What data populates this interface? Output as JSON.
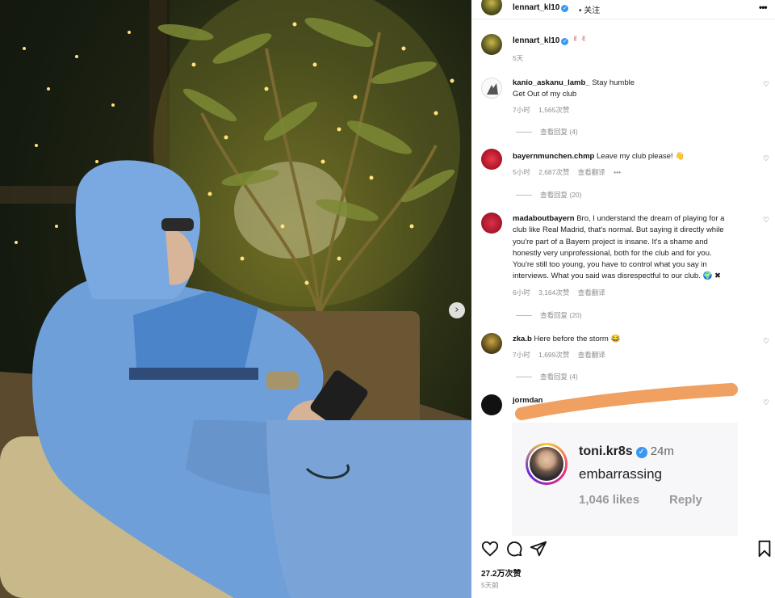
{
  "header": {
    "username": "lennart_kl10",
    "follow_label": "关注",
    "more_label": "•••"
  },
  "caption": {
    "username": "lennart_kl10",
    "emojis": "✌ ✌",
    "time": "5天"
  },
  "comments": [
    {
      "username": "kanio_askanu_lamb_",
      "text_line1": "Stay humble",
      "text_line2": "Get Out of my club",
      "time": "7小时",
      "likes": "1,565次赞",
      "view_replies": "查看回复 (4)"
    },
    {
      "username": "bayernmunchen.chmp",
      "text": "Leave my club please! 👋",
      "time": "5小时",
      "likes": "2,687次赞",
      "translate": "查看翻译",
      "more": "•••",
      "view_replies": "查看回复 (20)"
    },
    {
      "username": "madaboutbayern",
      "text_lines": [
        "Bro, I understand the dream of playing for a",
        "club like Real Madrid, that's normal. But saying it directly while",
        "you're part of a Bayern project is insane. It's a shame and",
        "honestly very unprofessional, both for the club and for you.",
        "You're still too young, you have to control what you say in",
        "interviews. What you said was disrespectful to our club. 🌍 ✖"
      ],
      "time": "6小时",
      "likes": "3,164次赞",
      "translate": "查看翻译",
      "view_replies": "查看回复 (20)"
    },
    {
      "username": "zka.b",
      "text": "Here before the storm 😂",
      "time": "7小时",
      "likes": "1,699次赞",
      "translate": "查看翻译",
      "view_replies": "查看回复 (4)"
    },
    {
      "username": "jormdan"
    }
  ],
  "reply_screenshot": {
    "username": "toni.kr8s",
    "time": "24m",
    "text": "embarrassing",
    "likes": "1,046 likes",
    "reply_label": "Reply"
  },
  "footer": {
    "likes": "27.2万次赞",
    "time": "5天前"
  },
  "colors": {
    "verified": "#3897f0",
    "scribble": "#f0a060",
    "meta_gray": "#8e8e8e"
  },
  "icons": {
    "next_arrow": "chevron-right-icon",
    "heart": "heart-icon",
    "comment": "comment-icon",
    "share": "share-icon",
    "save": "bookmark-icon"
  }
}
